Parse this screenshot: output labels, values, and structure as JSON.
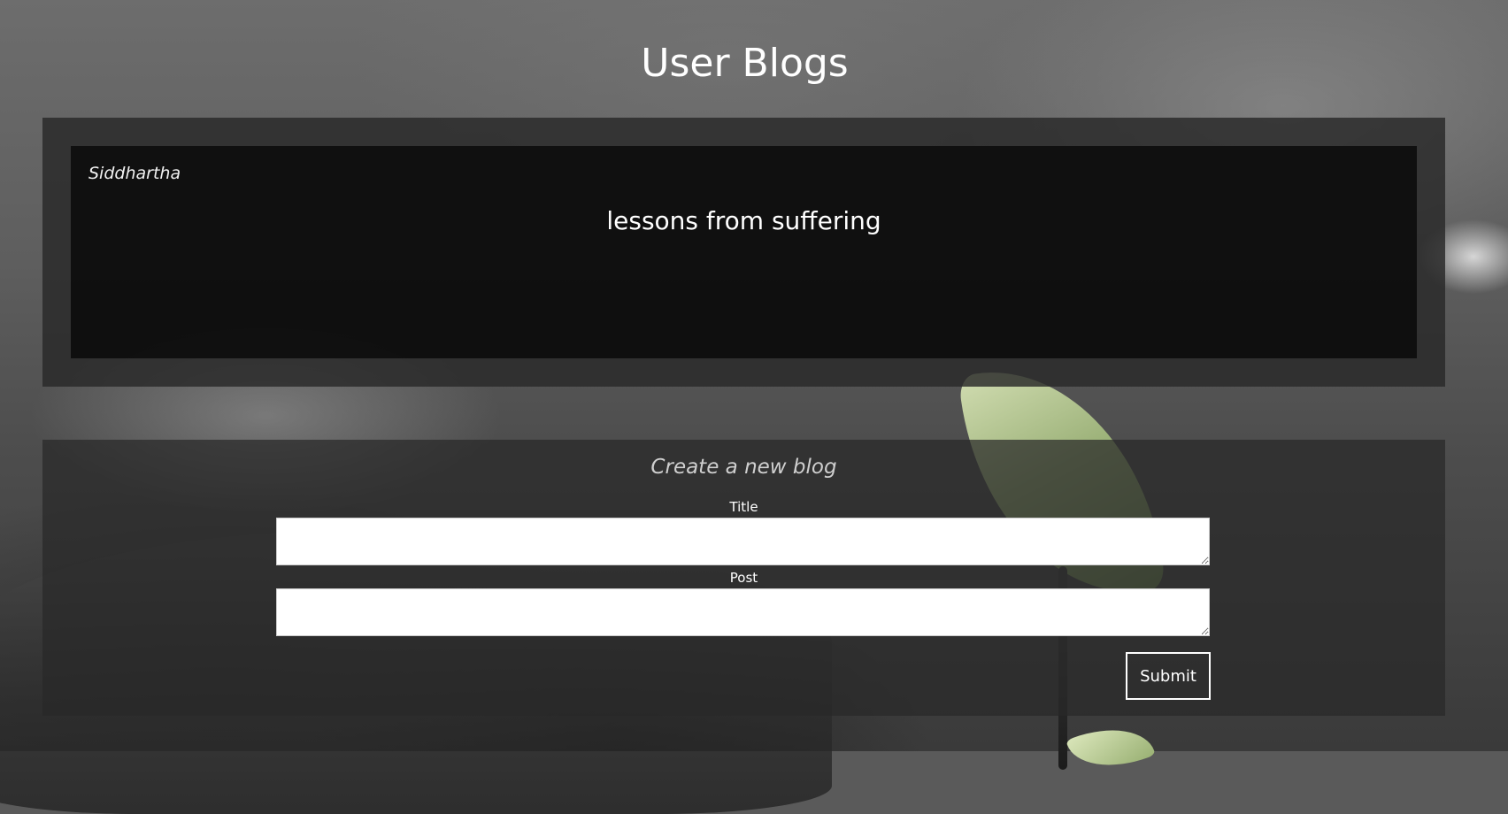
{
  "page": {
    "title": "User Blogs"
  },
  "blogs": [
    {
      "author": "Siddhartha",
      "title": "lessons from suffering"
    }
  ],
  "create_form": {
    "heading": "Create a new blog",
    "title_label": "Title",
    "title_value": "",
    "post_label": "Post",
    "post_value": "",
    "submit_label": "Submit"
  },
  "colors": {
    "panel_bg": "#282828",
    "card_bg": "#0c0c0c",
    "text": "#ffffff",
    "heading_muted": "#cfcfcf"
  }
}
